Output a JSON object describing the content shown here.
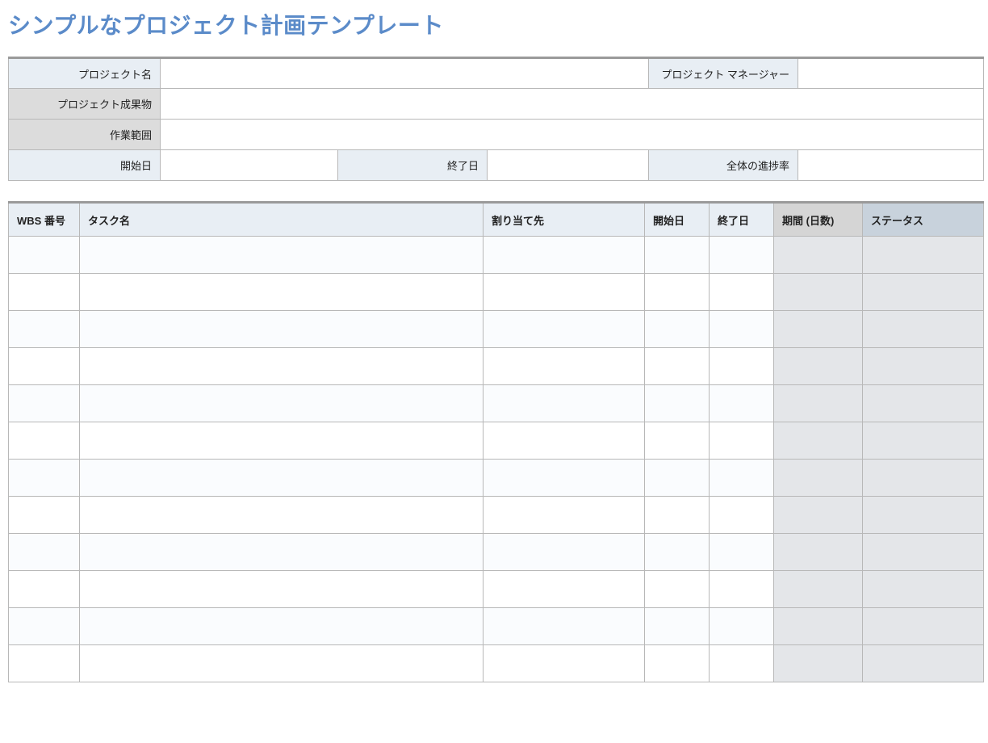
{
  "title": "シンプルなプロジェクト計画テンプレート",
  "info": {
    "projectNameLabel": "プロジェクト名",
    "projectNameValue": "",
    "projectManagerLabel": "プロジェクト マネージャー",
    "projectManagerValue": "",
    "deliverableLabel": "プロジェクト成果物",
    "deliverableValue": "",
    "scopeLabel": "作業範囲",
    "scopeValue": "",
    "startDateLabel": "開始日",
    "startDateValue": "",
    "endDateLabel": "終了日",
    "endDateValue": "",
    "progressLabel": "全体の進捗率",
    "progressValue": ""
  },
  "columns": {
    "wbs": "WBS 番号",
    "task": "タスク名",
    "assignee": "割り当て先",
    "start": "開始日",
    "end": "終了日",
    "duration": "期間 (日数)",
    "status": "ステータス"
  },
  "rows": [
    {
      "wbs": "",
      "task": "",
      "assignee": "",
      "start": "",
      "end": "",
      "duration": "",
      "status": ""
    },
    {
      "wbs": "",
      "task": "",
      "assignee": "",
      "start": "",
      "end": "",
      "duration": "",
      "status": ""
    },
    {
      "wbs": "",
      "task": "",
      "assignee": "",
      "start": "",
      "end": "",
      "duration": "",
      "status": ""
    },
    {
      "wbs": "",
      "task": "",
      "assignee": "",
      "start": "",
      "end": "",
      "duration": "",
      "status": ""
    },
    {
      "wbs": "",
      "task": "",
      "assignee": "",
      "start": "",
      "end": "",
      "duration": "",
      "status": ""
    },
    {
      "wbs": "",
      "task": "",
      "assignee": "",
      "start": "",
      "end": "",
      "duration": "",
      "status": ""
    },
    {
      "wbs": "",
      "task": "",
      "assignee": "",
      "start": "",
      "end": "",
      "duration": "",
      "status": ""
    },
    {
      "wbs": "",
      "task": "",
      "assignee": "",
      "start": "",
      "end": "",
      "duration": "",
      "status": ""
    },
    {
      "wbs": "",
      "task": "",
      "assignee": "",
      "start": "",
      "end": "",
      "duration": "",
      "status": ""
    },
    {
      "wbs": "",
      "task": "",
      "assignee": "",
      "start": "",
      "end": "",
      "duration": "",
      "status": ""
    },
    {
      "wbs": "",
      "task": "",
      "assignee": "",
      "start": "",
      "end": "",
      "duration": "",
      "status": ""
    },
    {
      "wbs": "",
      "task": "",
      "assignee": "",
      "start": "",
      "end": "",
      "duration": "",
      "status": ""
    }
  ]
}
